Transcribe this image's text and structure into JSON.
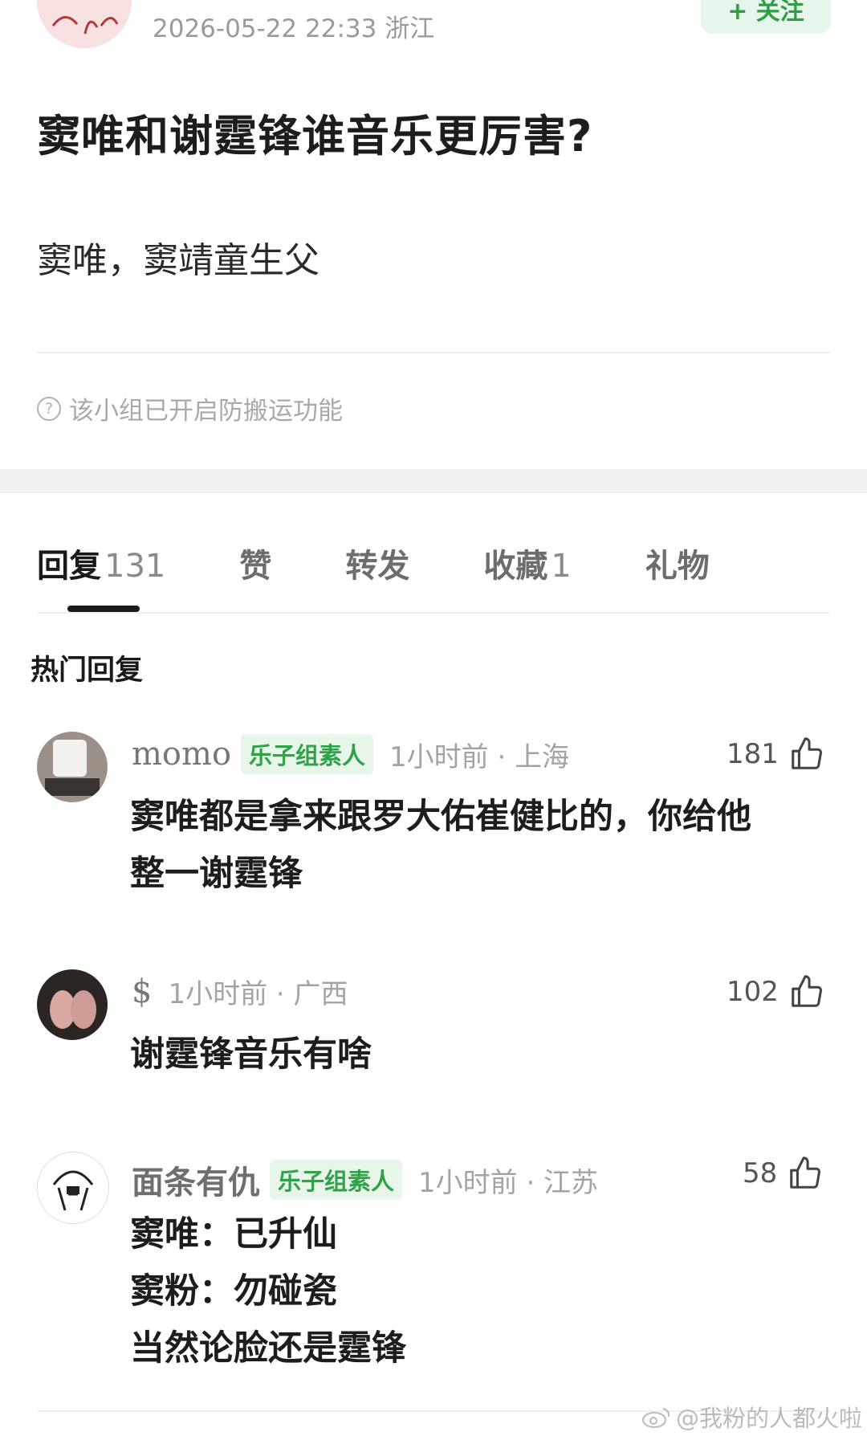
{
  "post": {
    "meta": "2026-05-22 22:33  浙江",
    "follow_label": "+ 关注",
    "title": "窦唯和谢霆锋谁音乐更厉害?",
    "body": "窦唯，窦靖童生父",
    "notice": "该小组已开启防搬运功能"
  },
  "tabs": [
    {
      "label": "回复",
      "count": "131"
    },
    {
      "label": "赞",
      "count": ""
    },
    {
      "label": "转发",
      "count": ""
    },
    {
      "label": "收藏",
      "count": "1"
    },
    {
      "label": "礼物",
      "count": ""
    }
  ],
  "section_title": "热门回复",
  "comments": [
    {
      "name": "momo",
      "tag": "乐子组素人",
      "time": "1小时前 · 上海",
      "likes": "181",
      "lines": [
        "窦唯都是拿来跟罗大佑崔健比的，你给他",
        "整一谢霆锋"
      ]
    },
    {
      "name": "$",
      "tag": "",
      "time": "1小时前 · 广西",
      "likes": "102",
      "lines": [
        "谢霆锋音乐有啥"
      ]
    },
    {
      "name": "面条有仇",
      "tag": "乐子组素人",
      "time": "1小时前 · 江苏",
      "likes": "58",
      "lines": [
        "窦唯：已升仙",
        "窦粉：勿碰瓷",
        "当然论脸还是霆锋"
      ]
    }
  ],
  "watermark": "@我粉的人都火啦",
  "colors": {
    "accent_green": "#31a24c",
    "tag_bg": "#e8f6ea"
  }
}
